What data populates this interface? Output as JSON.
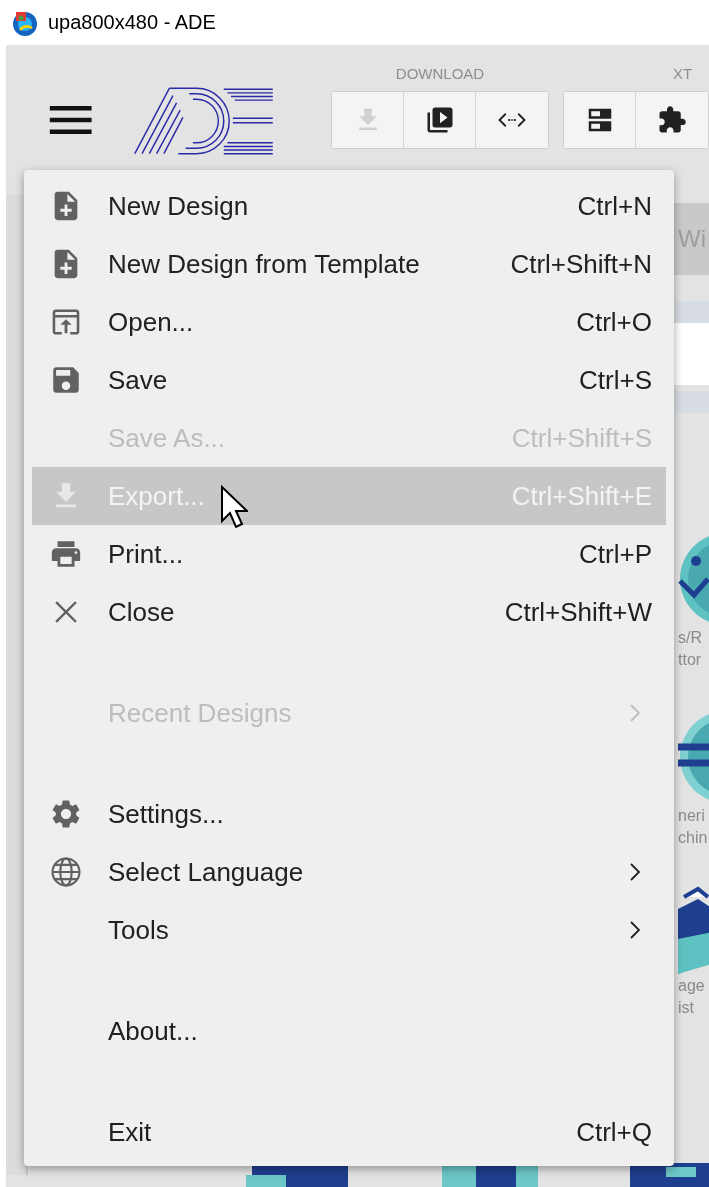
{
  "window": {
    "title": "upa800x480 - ADE"
  },
  "toolbar": {
    "groups": [
      {
        "label": "DOWNLOAD",
        "buttons": [
          {
            "disabled": true
          },
          {
            "disabled": false
          },
          {
            "disabled": false
          }
        ]
      },
      {
        "label": "XT",
        "buttons": [
          {
            "disabled": false
          },
          {
            "disabled": false
          }
        ]
      }
    ]
  },
  "background": {
    "tab_label": "Wi",
    "tiles": [
      {
        "lines": [
          "s/R",
          "ttor"
        ]
      },
      {
        "lines": [
          "neri",
          "chin"
        ]
      },
      {
        "lines": [
          "age",
          "ist"
        ]
      }
    ]
  },
  "menu": {
    "sections": [
      {
        "items": [
          {
            "label": "New Design",
            "shortcut": "Ctrl+N",
            "disabled": false,
            "highlighted": false,
            "submenu": false
          },
          {
            "label": "New Design from Template",
            "shortcut": "Ctrl+Shift+N",
            "disabled": false,
            "highlighted": false,
            "submenu": false
          },
          {
            "label": "Open...",
            "shortcut": "Ctrl+O",
            "disabled": false,
            "highlighted": false,
            "submenu": false
          },
          {
            "label": "Save",
            "shortcut": "Ctrl+S",
            "disabled": false,
            "highlighted": false,
            "submenu": false
          },
          {
            "label": "Save As...",
            "shortcut": "Ctrl+Shift+S",
            "disabled": true,
            "highlighted": false,
            "submenu": false
          },
          {
            "label": "Export...",
            "shortcut": "Ctrl+Shift+E",
            "disabled": true,
            "highlighted": true,
            "submenu": false
          },
          {
            "label": "Print...",
            "shortcut": "Ctrl+P",
            "disabled": false,
            "highlighted": false,
            "submenu": false
          },
          {
            "label": "Close",
            "shortcut": "Ctrl+Shift+W",
            "disabled": false,
            "highlighted": false,
            "submenu": false
          }
        ]
      },
      {
        "items": [
          {
            "label": "Recent Designs",
            "disabled": true,
            "highlighted": false,
            "submenu": true
          }
        ]
      },
      {
        "items": [
          {
            "label": "Settings...",
            "disabled": false,
            "highlighted": false,
            "submenu": false
          },
          {
            "label": "Select Language",
            "disabled": false,
            "highlighted": false,
            "submenu": true
          },
          {
            "label": "Tools",
            "disabled": false,
            "highlighted": false,
            "submenu": true
          }
        ]
      },
      {
        "items": [
          {
            "label": "About...",
            "disabled": false,
            "highlighted": false,
            "submenu": false
          }
        ]
      },
      {
        "items": [
          {
            "label": "Exit",
            "shortcut": "Ctrl+Q",
            "disabled": false,
            "highlighted": false,
            "submenu": false
          }
        ]
      }
    ]
  }
}
